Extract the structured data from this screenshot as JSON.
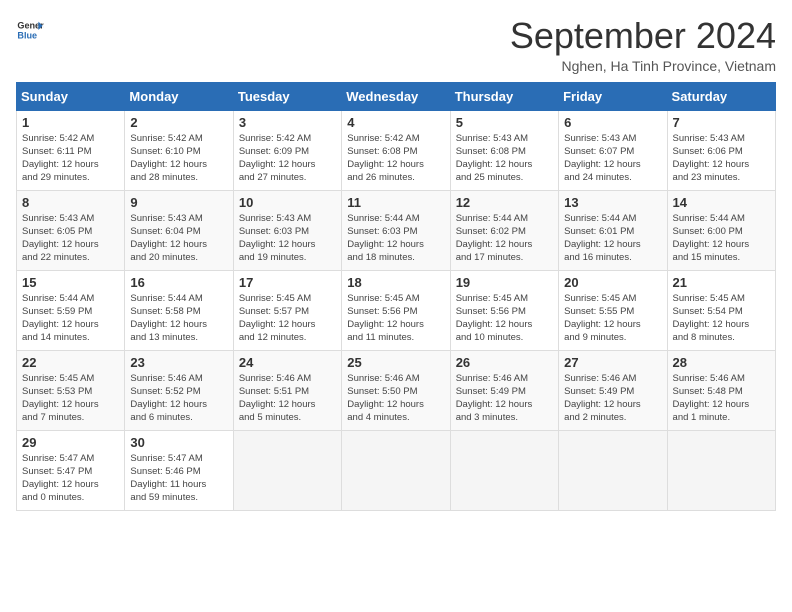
{
  "header": {
    "logo_general": "General",
    "logo_blue": "Blue",
    "title": "September 2024",
    "subtitle": "Nghen, Ha Tinh Province, Vietnam"
  },
  "days_of_week": [
    "Sunday",
    "Monday",
    "Tuesday",
    "Wednesday",
    "Thursday",
    "Friday",
    "Saturday"
  ],
  "weeks": [
    [
      {
        "day": "1",
        "sunrise": "5:42 AM",
        "sunset": "6:11 PM",
        "daylight": "12 hours and 29 minutes."
      },
      {
        "day": "2",
        "sunrise": "5:42 AM",
        "sunset": "6:10 PM",
        "daylight": "12 hours and 28 minutes."
      },
      {
        "day": "3",
        "sunrise": "5:42 AM",
        "sunset": "6:09 PM",
        "daylight": "12 hours and 27 minutes."
      },
      {
        "day": "4",
        "sunrise": "5:42 AM",
        "sunset": "6:08 PM",
        "daylight": "12 hours and 26 minutes."
      },
      {
        "day": "5",
        "sunrise": "5:43 AM",
        "sunset": "6:08 PM",
        "daylight": "12 hours and 25 minutes."
      },
      {
        "day": "6",
        "sunrise": "5:43 AM",
        "sunset": "6:07 PM",
        "daylight": "12 hours and 24 minutes."
      },
      {
        "day": "7",
        "sunrise": "5:43 AM",
        "sunset": "6:06 PM",
        "daylight": "12 hours and 23 minutes."
      }
    ],
    [
      {
        "day": "8",
        "sunrise": "5:43 AM",
        "sunset": "6:05 PM",
        "daylight": "12 hours and 22 minutes."
      },
      {
        "day": "9",
        "sunrise": "5:43 AM",
        "sunset": "6:04 PM",
        "daylight": "12 hours and 20 minutes."
      },
      {
        "day": "10",
        "sunrise": "5:43 AM",
        "sunset": "6:03 PM",
        "daylight": "12 hours and 19 minutes."
      },
      {
        "day": "11",
        "sunrise": "5:44 AM",
        "sunset": "6:03 PM",
        "daylight": "12 hours and 18 minutes."
      },
      {
        "day": "12",
        "sunrise": "5:44 AM",
        "sunset": "6:02 PM",
        "daylight": "12 hours and 17 minutes."
      },
      {
        "day": "13",
        "sunrise": "5:44 AM",
        "sunset": "6:01 PM",
        "daylight": "12 hours and 16 minutes."
      },
      {
        "day": "14",
        "sunrise": "5:44 AM",
        "sunset": "6:00 PM",
        "daylight": "12 hours and 15 minutes."
      }
    ],
    [
      {
        "day": "15",
        "sunrise": "5:44 AM",
        "sunset": "5:59 PM",
        "daylight": "12 hours and 14 minutes."
      },
      {
        "day": "16",
        "sunrise": "5:44 AM",
        "sunset": "5:58 PM",
        "daylight": "12 hours and 13 minutes."
      },
      {
        "day": "17",
        "sunrise": "5:45 AM",
        "sunset": "5:57 PM",
        "daylight": "12 hours and 12 minutes."
      },
      {
        "day": "18",
        "sunrise": "5:45 AM",
        "sunset": "5:56 PM",
        "daylight": "12 hours and 11 minutes."
      },
      {
        "day": "19",
        "sunrise": "5:45 AM",
        "sunset": "5:56 PM",
        "daylight": "12 hours and 10 minutes."
      },
      {
        "day": "20",
        "sunrise": "5:45 AM",
        "sunset": "5:55 PM",
        "daylight": "12 hours and 9 minutes."
      },
      {
        "day": "21",
        "sunrise": "5:45 AM",
        "sunset": "5:54 PM",
        "daylight": "12 hours and 8 minutes."
      }
    ],
    [
      {
        "day": "22",
        "sunrise": "5:45 AM",
        "sunset": "5:53 PM",
        "daylight": "12 hours and 7 minutes."
      },
      {
        "day": "23",
        "sunrise": "5:46 AM",
        "sunset": "5:52 PM",
        "daylight": "12 hours and 6 minutes."
      },
      {
        "day": "24",
        "sunrise": "5:46 AM",
        "sunset": "5:51 PM",
        "daylight": "12 hours and 5 minutes."
      },
      {
        "day": "25",
        "sunrise": "5:46 AM",
        "sunset": "5:50 PM",
        "daylight": "12 hours and 4 minutes."
      },
      {
        "day": "26",
        "sunrise": "5:46 AM",
        "sunset": "5:49 PM",
        "daylight": "12 hours and 3 minutes."
      },
      {
        "day": "27",
        "sunrise": "5:46 AM",
        "sunset": "5:49 PM",
        "daylight": "12 hours and 2 minutes."
      },
      {
        "day": "28",
        "sunrise": "5:46 AM",
        "sunset": "5:48 PM",
        "daylight": "12 hours and 1 minute."
      }
    ],
    [
      {
        "day": "29",
        "sunrise": "5:47 AM",
        "sunset": "5:47 PM",
        "daylight": "12 hours and 0 minutes."
      },
      {
        "day": "30",
        "sunrise": "5:47 AM",
        "sunset": "5:46 PM",
        "daylight": "11 hours and 59 minutes."
      },
      null,
      null,
      null,
      null,
      null
    ]
  ],
  "labels": {
    "sunrise": "Sunrise:",
    "sunset": "Sunset:",
    "daylight": "Daylight:"
  }
}
